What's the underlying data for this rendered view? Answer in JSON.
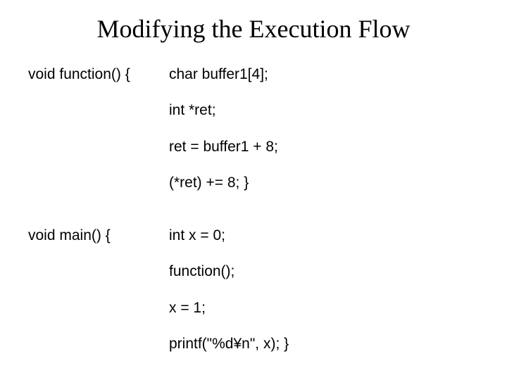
{
  "title": "Modifying the Execution Flow",
  "code": {
    "func_decl": "void function() {",
    "func_body": [
      "char buffer1[4];",
      "int *ret;",
      "ret = buffer1 + 8;",
      "(*ret) += 8;  }"
    ],
    "main_decl": "void main() {",
    "main_body": [
      "int x = 0;",
      "function();",
      "x = 1;",
      "printf(\"%d¥n\", x);  }"
    ]
  }
}
